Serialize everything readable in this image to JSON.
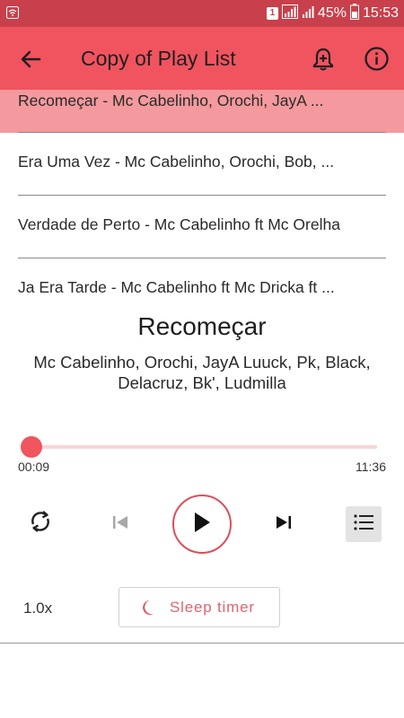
{
  "status_bar": {
    "sim_slot": "1",
    "battery": "45%",
    "time": "15:53"
  },
  "header": {
    "title": "Copy of Play List",
    "back_icon": "arrow-left-icon",
    "alarm_icon": "alarm-add-icon",
    "info_icon": "info-icon"
  },
  "playlist": {
    "items": [
      {
        "label": "Recomeçar - Mc Cabelinho, Orochi, JayA ..."
      },
      {
        "label": "Era Uma Vez - Mc Cabelinho, Orochi, Bob, ..."
      },
      {
        "label": "Verdade de Perto - Mc Cabelinho ft Mc Orelha"
      },
      {
        "label": "Ja Era Tarde - Mc Cabelinho ft Mc Dricka ft ..."
      }
    ]
  },
  "now_playing": {
    "title": "Recomeçar",
    "artist": "Mc Cabelinho, Orochi, JayA Luuck, Pk, Black, Delacruz, Bk', Ludmilla",
    "current_time": "00:09",
    "total_time": "11:36",
    "progress_fraction": 0.013
  },
  "controls": {
    "speed": "1.0x",
    "sleep_timer": "Sleep timer"
  },
  "colors": {
    "status_bar": "#c8404b",
    "app_bar": "#f0545f",
    "active_row": "#f4999d",
    "accent": "#f0545f"
  }
}
